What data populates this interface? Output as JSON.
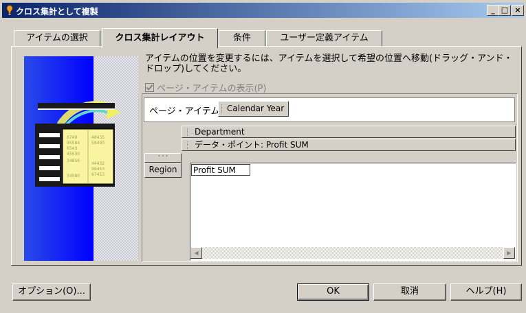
{
  "window": {
    "title": "クロス集計として複製",
    "controls": [
      "_",
      "□",
      "×"
    ]
  },
  "tabs": [
    {
      "label": "アイテムの選択"
    },
    {
      "label": "クロス集計レイアウト",
      "active": true
    },
    {
      "label": "条件"
    },
    {
      "label": "ユーザー定義アイテム"
    }
  ],
  "instructions": "アイテムの位置を変更するには、アイテムを選択して希望の位置へ移動(ドラッグ・アンド・ドロップ)してください。",
  "show_page_items": {
    "label": "ページ・アイテムの表示(P)",
    "checked": true,
    "enabled": false
  },
  "layout": {
    "page_items_label": "ページ・アイテム:",
    "page_item": "Calendar Year",
    "column_items": [
      "Department",
      "データ・ポイント: Profit SUM"
    ],
    "row_placeholder": "· · ·",
    "row_item": "Region",
    "data_cell": "Profit SUM",
    "scroll_left": "◀",
    "scroll_right": "▶"
  },
  "illustration": {
    "numbers_left": [
      "6749",
      "95584",
      "6543",
      "45630",
      "34856",
      "",
      "34580"
    ],
    "numbers_right": [
      "48435",
      "58493",
      "",
      "",
      "44432",
      "96453",
      "67453"
    ]
  },
  "buttons": {
    "options": "オプション(O)...",
    "ok": "OK",
    "cancel": "取消",
    "help": "ヘルプ(H)"
  }
}
